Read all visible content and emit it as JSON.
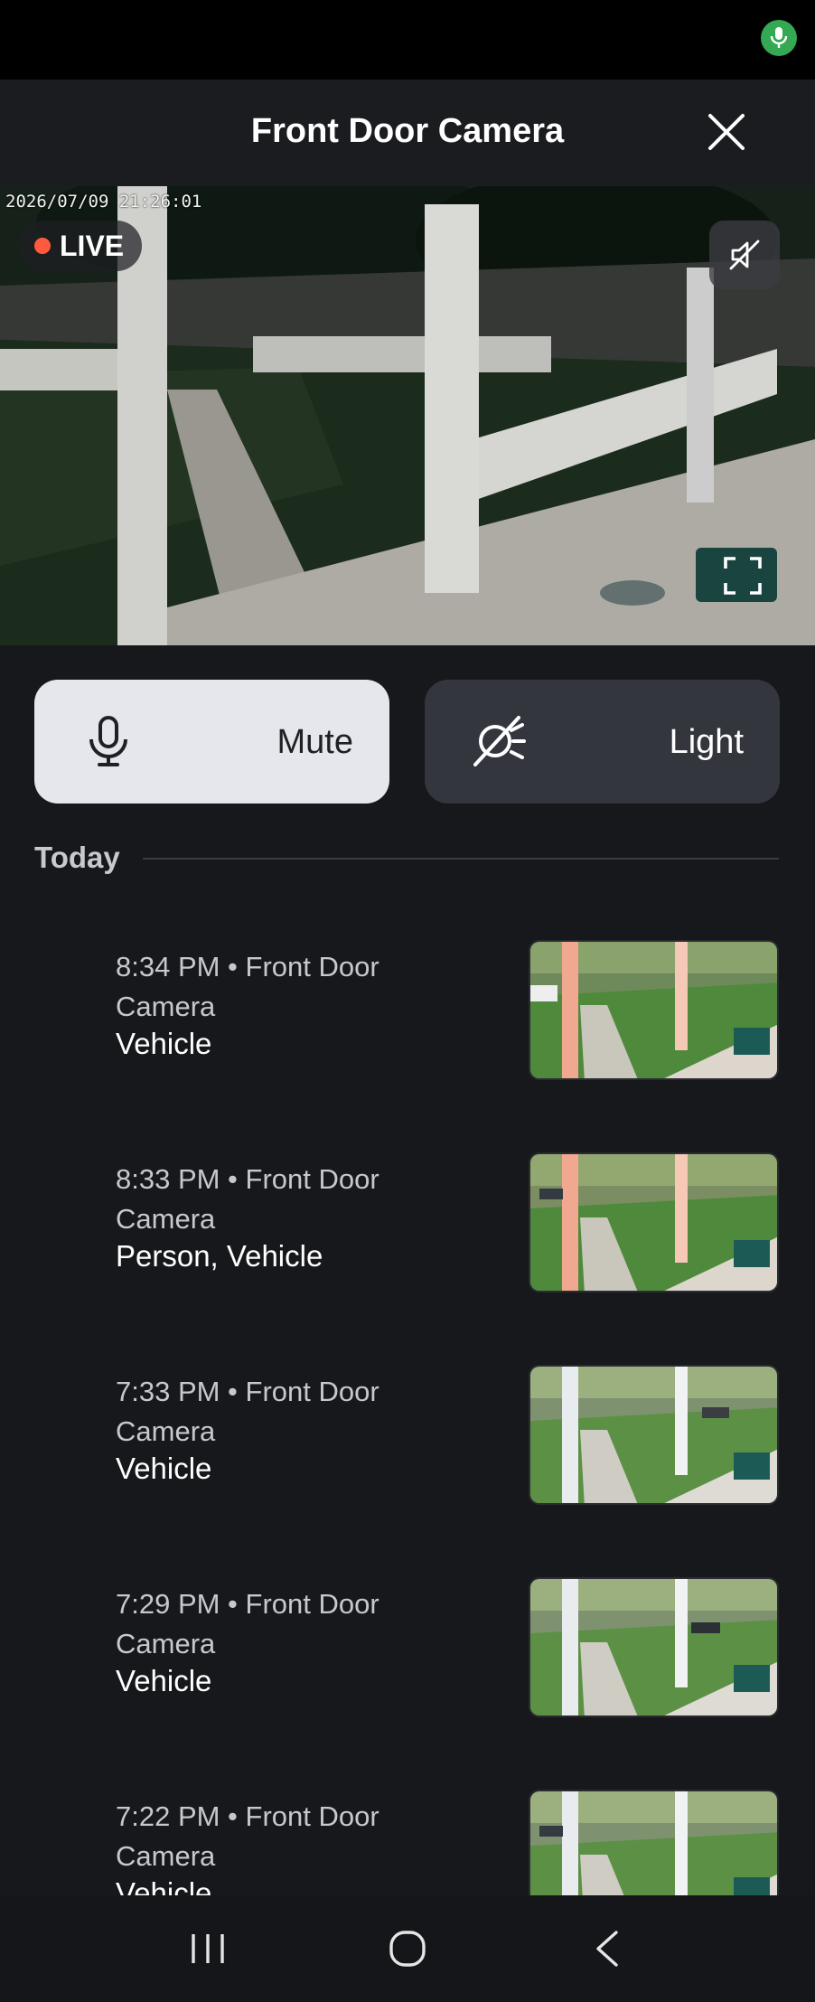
{
  "status_bar": {
    "mic_icon": "microphone-icon",
    "mic_color": "#34a853"
  },
  "header": {
    "title": "Front Door Camera",
    "close_icon": "close-icon"
  },
  "feed": {
    "timestamp": "2026/07/09 21:26:01",
    "live_label": "LIVE",
    "live_color": "#ff5a3d",
    "audio_icon": "speaker-muted-icon",
    "fullscreen_icon": "fullscreen-icon"
  },
  "controls": {
    "mute": {
      "label": "Mute",
      "icon": "microphone-icon"
    },
    "light": {
      "label": "Light",
      "icon": "light-off-icon"
    }
  },
  "section": {
    "label": "Today"
  },
  "events": [
    {
      "meta": "8:34 PM • Front Door Camera",
      "type": "Vehicle"
    },
    {
      "meta": "8:33 PM • Front Door Camera",
      "type": "Person, Vehicle"
    },
    {
      "meta": "7:33 PM • Front Door Camera",
      "type": "Vehicle"
    },
    {
      "meta": "7:29 PM • Front Door Camera",
      "type": "Vehicle"
    },
    {
      "meta": "7:22 PM • Front Door Camera",
      "type": "Vehicle"
    }
  ],
  "nav": {
    "recents_icon": "recents-icon",
    "home_icon": "home-icon",
    "back_icon": "back-icon"
  }
}
